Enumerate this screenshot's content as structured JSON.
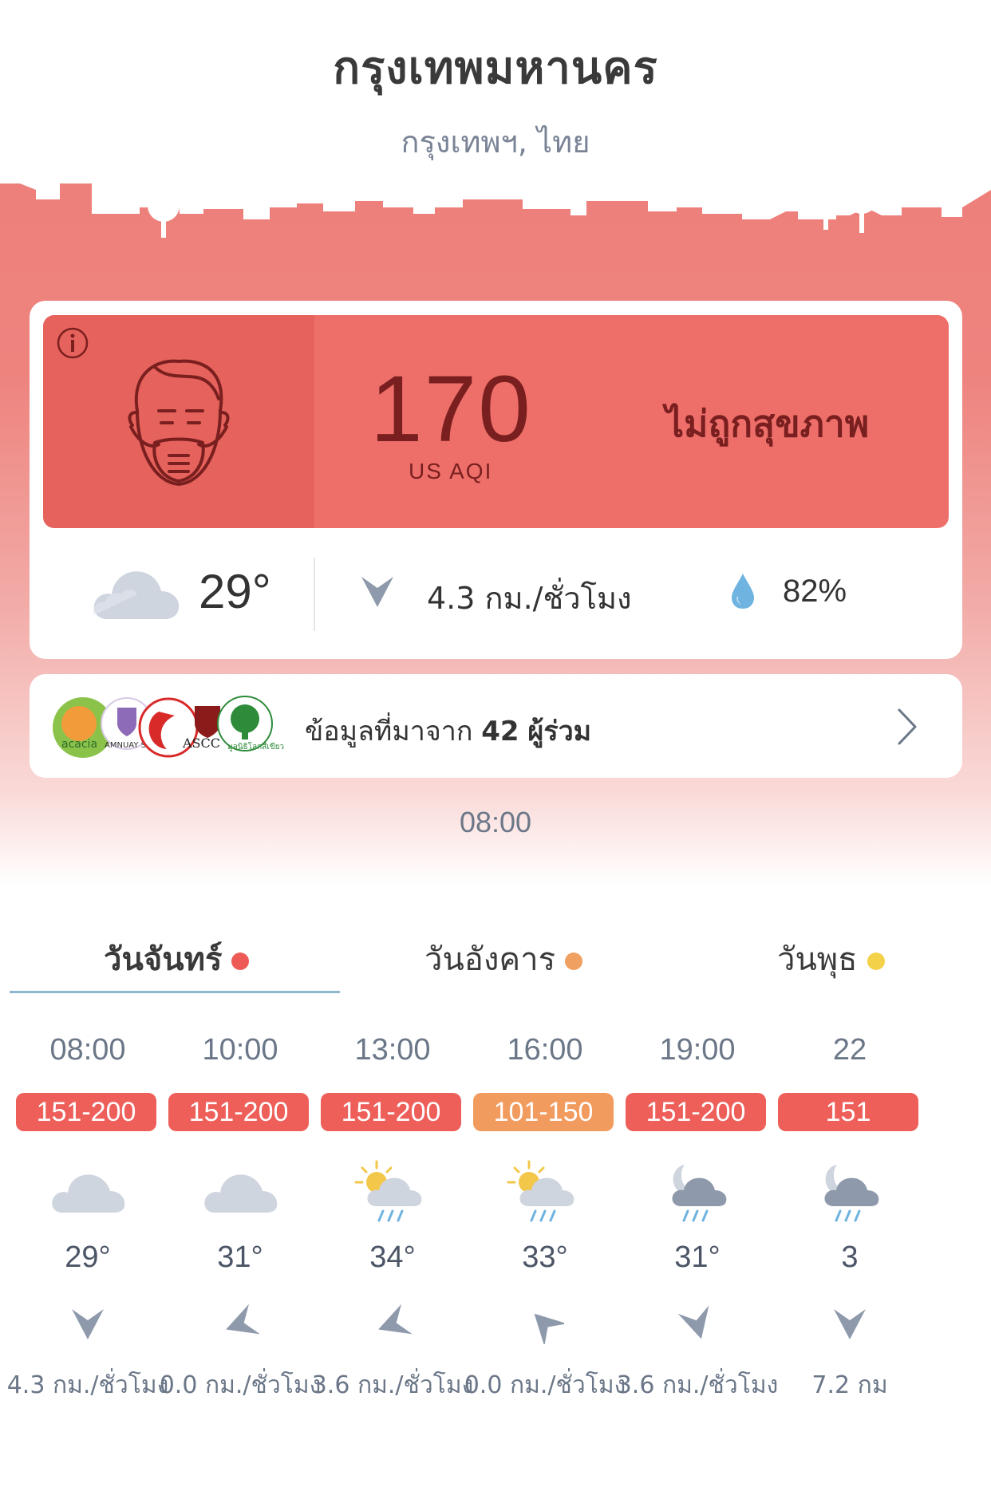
{
  "location": {
    "city": "กรุงเทพมหานคร",
    "region": "กรุงเทพฯ, ไทย"
  },
  "aqi": {
    "value": "170",
    "unit": "US AQI",
    "status": "ไม่ถูกสุขภาพ",
    "color": "#ee6f6a"
  },
  "weather": {
    "temperature": "29°",
    "wind": "4.3 กม./ชั่วโมง",
    "humidity": "82%"
  },
  "contributors": {
    "prefix": "ข้อมูลที่มาจาก",
    "count": "42",
    "suffix": "ผู้ร่วม"
  },
  "timestamp": "08:00",
  "days": [
    {
      "label": "วันจันทร์",
      "dot_color": "#ee5a55",
      "active": true
    },
    {
      "label": "วันอังคาร",
      "dot_color": "#f0a060",
      "active": false
    },
    {
      "label": "วันพุธ",
      "dot_color": "#f3d24a",
      "active": false
    }
  ],
  "hourly": [
    {
      "time": "08:00",
      "aqi_range": "151-200",
      "badge_color": "#ee5f5a",
      "icon": "cloud-icon",
      "temp": "29°",
      "wind": "4.3 กม./ชั่วโมง"
    },
    {
      "time": "10:00",
      "aqi_range": "151-200",
      "badge_color": "#ee5f5a",
      "icon": "cloud-icon",
      "temp": "31°",
      "wind": "0.0 กม./ชั่วโมง"
    },
    {
      "time": "13:00",
      "aqi_range": "151-200",
      "badge_color": "#ee5f5a",
      "icon": "sun-rain-icon",
      "temp": "34°",
      "wind": "3.6 กม./ชั่วโมง"
    },
    {
      "time": "16:00",
      "aqi_range": "101-150",
      "badge_color": "#f29b5e",
      "icon": "sun-rain-icon",
      "temp": "33°",
      "wind": "0.0 กม./ชั่วโมง"
    },
    {
      "time": "19:00",
      "aqi_range": "151-200",
      "badge_color": "#ee5f5a",
      "icon": "moon-rain-icon",
      "temp": "31°",
      "wind": "3.6 กม./ชั่วโมง"
    },
    {
      "time": "22",
      "aqi_range": "151",
      "badge_color": "#ee5f5a",
      "icon": "moon-rain-icon",
      "temp": "3",
      "wind": "7.2 กม"
    }
  ]
}
